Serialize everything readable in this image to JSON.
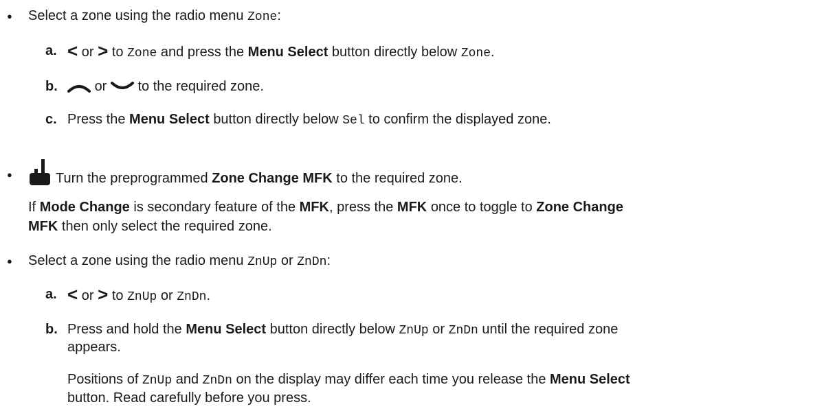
{
  "b1": {
    "text_before": "Select a zone using the radio menu ",
    "code": "Zone",
    "text_after": ":",
    "steps": {
      "a": {
        "label": "a.",
        "or": "or",
        "to": "to",
        "code1": "Zone",
        "mid": "and press the",
        "bold": "Menu Select",
        "end": "button directly below",
        "code2": "Zone",
        "period": "."
      },
      "b": {
        "label": "b.",
        "or": "or",
        "rest": "to the required zone."
      },
      "c": {
        "label": "c.",
        "text1": "Press the",
        "bold": "Menu Select",
        "text2": "button directly below",
        "code": "Sel",
        "text3": "to confirm the displayed zone."
      }
    }
  },
  "b2": {
    "icon": "portable-radio-icon",
    "line1_pre": "Turn the preprogrammed",
    "line1_bold": "Zone Change MFK",
    "line1_post": "to the required zone.",
    "line2_pre": "If",
    "line2_bold1": "Mode Change",
    "line2_mid1": "is secondary feature of the",
    "line2_bold2": "MFK",
    "line2_mid2": ", press the",
    "line2_bold3": "MFK",
    "line2_mid3": "once to toggle to",
    "line2_bold4": "Zone Change",
    "line3_bold": "MFK",
    "line3_post": "then only select the required zone."
  },
  "b3": {
    "text_before": "Select a zone using the radio menu",
    "code1": "ZnUp",
    "or": "or",
    "code2": "ZnDn",
    "text_after": ":",
    "steps": {
      "a": {
        "label": "a.",
        "or": "or",
        "to": "to",
        "code1": "ZnUp",
        "or2": "or",
        "code2": "ZnDn",
        "period": "."
      },
      "b": {
        "label": "b.",
        "text1": "Press and hold the",
        "bold": "Menu Select",
        "text2": "button directly below",
        "code1": "ZnUp",
        "or": "or",
        "code2": "ZnDn",
        "text3": "until the required zone",
        "line2": "appears.",
        "note1_pre": "Positions of",
        "note1_code1": "ZnUp",
        "note1_and": "and",
        "note1_code2": "ZnDn",
        "note1_mid": "on the display may differ each time you release the",
        "note1_bold": "Menu Select",
        "note2": "button. Read carefully before you press."
      }
    }
  },
  "icons": {
    "left": "chevron-left-icon",
    "right": "chevron-right-icon",
    "up": "arc-up-icon",
    "down": "arc-down-icon"
  }
}
